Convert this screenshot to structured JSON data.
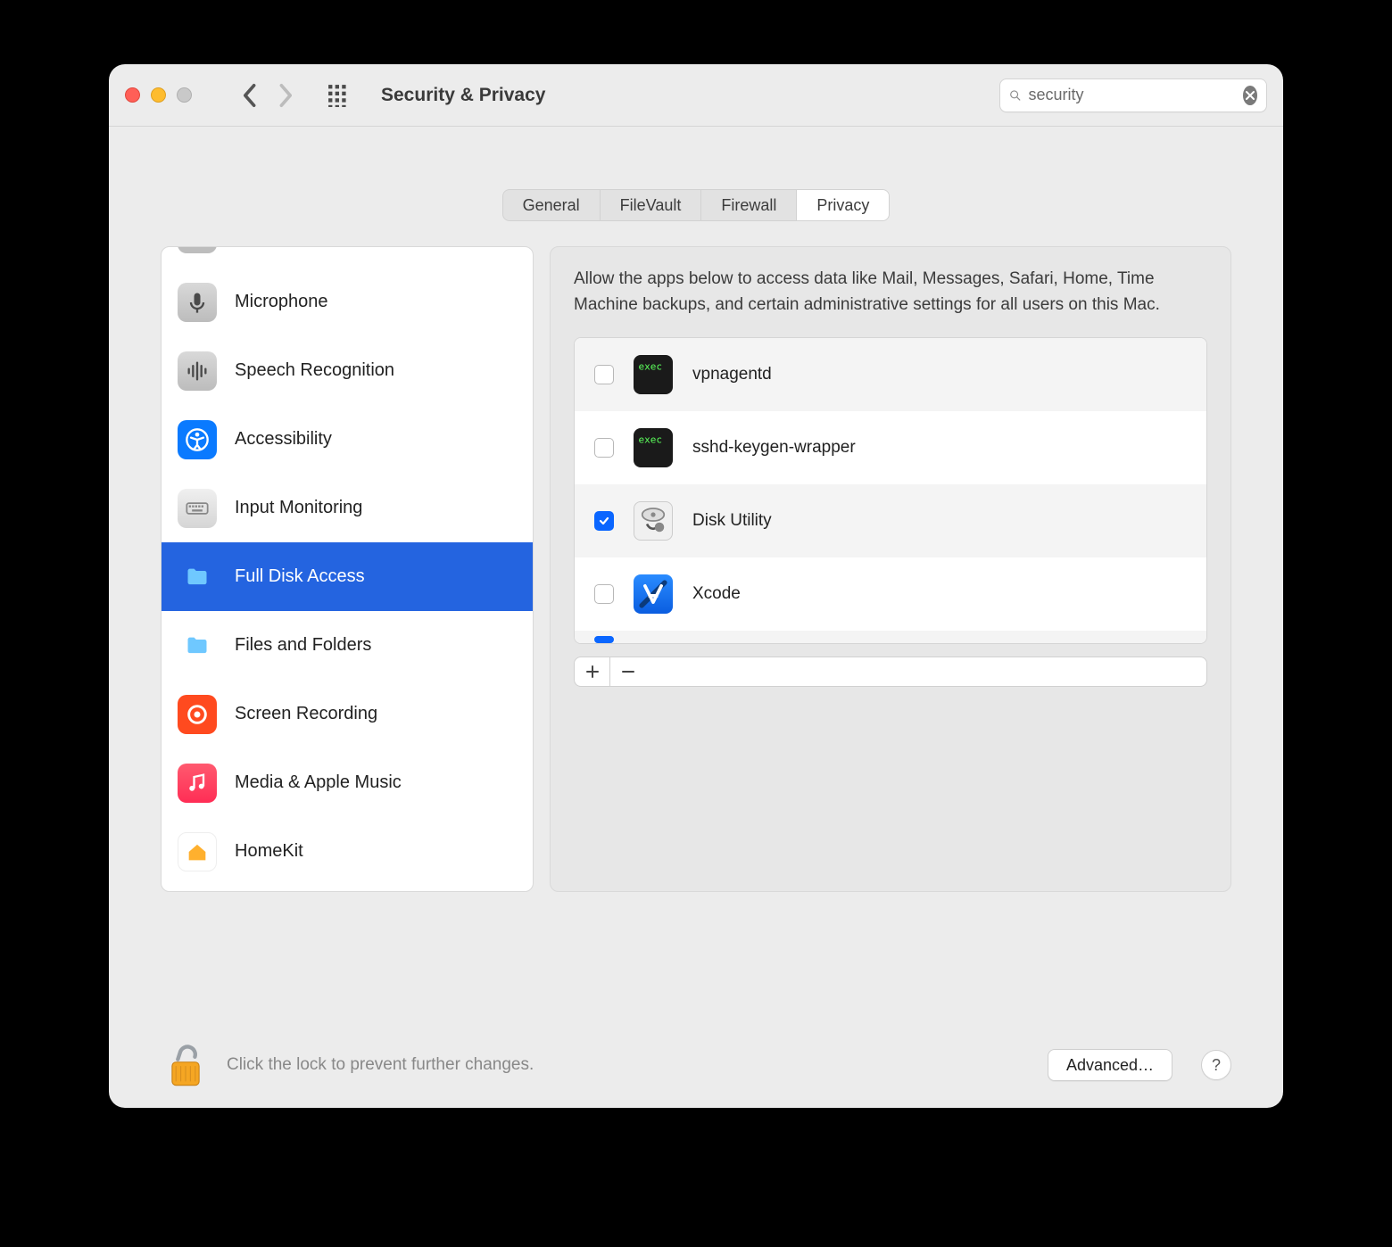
{
  "window": {
    "title": "Security & Privacy"
  },
  "search": {
    "value": "security"
  },
  "tabs": [
    {
      "label": "General",
      "active": false
    },
    {
      "label": "FileVault",
      "active": false
    },
    {
      "label": "Firewall",
      "active": false
    },
    {
      "label": "Privacy",
      "active": true
    }
  ],
  "sidebar": {
    "items": [
      {
        "label": "",
        "icon": "generic-partial",
        "selected": false
      },
      {
        "label": "Microphone",
        "icon": "microphone-icon",
        "selected": false
      },
      {
        "label": "Speech Recognition",
        "icon": "speech-icon",
        "selected": false
      },
      {
        "label": "Accessibility",
        "icon": "accessibility-icon",
        "selected": false
      },
      {
        "label": "Input Monitoring",
        "icon": "keyboard-icon",
        "selected": false
      },
      {
        "label": "Full Disk Access",
        "icon": "folder-icon",
        "selected": true
      },
      {
        "label": "Files and Folders",
        "icon": "folder-icon",
        "selected": false
      },
      {
        "label": "Screen Recording",
        "icon": "record-icon",
        "selected": false
      },
      {
        "label": "Media & Apple Music",
        "icon": "music-icon",
        "selected": false
      },
      {
        "label": "HomeKit",
        "icon": "home-icon",
        "selected": false
      }
    ]
  },
  "description": "Allow the apps below to access data like Mail, Messages, Safari, Home, Time Machine backups, and certain administrative settings for all users on this Mac.",
  "apps": [
    {
      "name": "vpnagentd",
      "checked": false,
      "icon": "terminal-icon"
    },
    {
      "name": "sshd-keygen-wrapper",
      "checked": false,
      "icon": "terminal-icon"
    },
    {
      "name": "Disk Utility",
      "checked": true,
      "icon": "diskutility-icon"
    },
    {
      "name": "Xcode",
      "checked": false,
      "icon": "xcode-icon"
    }
  ],
  "footer": {
    "lock_text": "Click the lock to prevent further changes.",
    "advanced_label": "Advanced…"
  }
}
